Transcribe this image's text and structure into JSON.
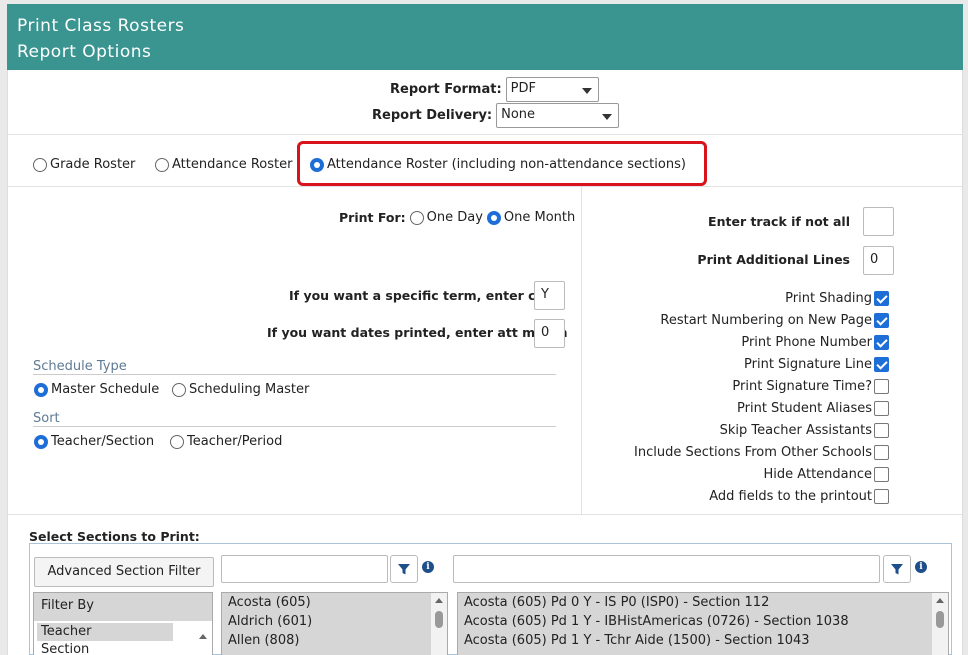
{
  "header": {
    "title": "Print Class Rosters",
    "subtitle": "Report Options"
  },
  "report": {
    "format_label": "Report Format:",
    "format_value": "PDF",
    "delivery_label": "Report Delivery:",
    "delivery_value": "None"
  },
  "roster_types": [
    {
      "label": "Grade Roster",
      "selected": false
    },
    {
      "label": "Attendance Roster",
      "selected": false
    },
    {
      "label": "Attendance Roster (including non-attendance sections)",
      "selected": true
    }
  ],
  "print_for": {
    "label": "Print For:",
    "options": [
      {
        "label": "One Day",
        "selected": false
      },
      {
        "label": "One Month",
        "selected": true
      }
    ]
  },
  "term": {
    "label": "If you want a specific term, enter code",
    "value": "Y"
  },
  "att_month": {
    "label": "If you want dates printed, enter att month",
    "value": "0"
  },
  "schedule_type": {
    "heading": "Schedule Type",
    "options": [
      {
        "label": "Master Schedule",
        "selected": true
      },
      {
        "label": "Scheduling Master",
        "selected": false
      }
    ]
  },
  "sort": {
    "heading": "Sort",
    "options": [
      {
        "label": "Teacher/Section",
        "selected": true
      },
      {
        "label": "Teacher/Period",
        "selected": false
      }
    ]
  },
  "track": {
    "label": "Enter track if not all",
    "value": ""
  },
  "additional_lines": {
    "label": "Print Additional Lines",
    "value": "0"
  },
  "options": [
    {
      "label": "Print Shading",
      "checked": true
    },
    {
      "label": "Restart Numbering on New Page",
      "checked": true
    },
    {
      "label": "Print Phone Number",
      "checked": true
    },
    {
      "label": "Print Signature Line",
      "checked": true
    },
    {
      "label": "Print Signature Time?",
      "checked": false
    },
    {
      "label": "Print Student Aliases",
      "checked": false
    },
    {
      "label": "Skip Teacher Assistants",
      "checked": false
    },
    {
      "label": "Include Sections From Other Schools",
      "checked": false
    },
    {
      "label": "Hide Attendance",
      "checked": false
    },
    {
      "label": "Add fields to the printout",
      "checked": false
    }
  ],
  "sections": {
    "title": "Select Sections to Print:",
    "advanced_filter_label": "Advanced Section Filter",
    "filter_by_label": "Filter By",
    "filter_by_items": [
      "Teacher",
      "Section"
    ],
    "teachers": [
      "Acosta (605)",
      "Aldrich (601)",
      "Allen (808)"
    ],
    "section_list": [
      "Acosta (605) Pd 0 Y - IS P0 (ISP0) - Section 112",
      "Acosta (605) Pd 1 Y - IBHistAmericas (0726) - Section 1038",
      "Acosta (605) Pd 1 Y - Tchr Aide (1500) - Section 1043"
    ]
  },
  "colors": {
    "header_bg": "#3a9590",
    "accent": "#1e6ed8",
    "highlight": "#d9131b"
  }
}
